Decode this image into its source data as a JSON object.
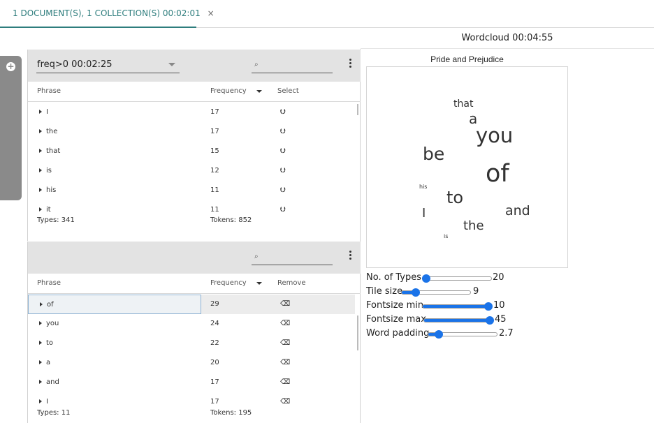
{
  "tab": {
    "label": "1 DOCUMENT(S), 1 COLLECTION(S) 00:02:01",
    "close": "×"
  },
  "right_panel": {
    "title": "Wordcloud 00:04:55"
  },
  "rail": {
    "add_icon": "plus-circle-icon"
  },
  "top_panel": {
    "select_value": "freq>0 00:02:25",
    "search_placeholder": "",
    "columns": {
      "phrase": "Phrase",
      "frequency": "Frequency",
      "action": "Select"
    },
    "rows": [
      {
        "phrase": "I",
        "frequency": "17"
      },
      {
        "phrase": "the",
        "frequency": "17"
      },
      {
        "phrase": "that",
        "frequency": "15"
      },
      {
        "phrase": "is",
        "frequency": "12"
      },
      {
        "phrase": "his",
        "frequency": "11"
      },
      {
        "phrase": "it",
        "frequency": "11"
      }
    ],
    "action_icon": "download-icon",
    "types": "Types: 341",
    "tokens": "Tokens: 852"
  },
  "bottom_panel": {
    "search_placeholder": "",
    "columns": {
      "phrase": "Phrase",
      "frequency": "Frequency",
      "action": "Remove"
    },
    "rows": [
      {
        "phrase": "of",
        "frequency": "29"
      },
      {
        "phrase": "you",
        "frequency": "24"
      },
      {
        "phrase": "to",
        "frequency": "22"
      },
      {
        "phrase": "a",
        "frequency": "20"
      },
      {
        "phrase": "and",
        "frequency": "17"
      },
      {
        "phrase": "I",
        "frequency": "17"
      }
    ],
    "action_icon": "eraser-icon",
    "types": "Types: 11",
    "tokens": "Tokens: 195"
  },
  "wordcloud": {
    "title": "Pride and Prejudice",
    "words": [
      "that",
      "a",
      "you",
      "be",
      "of",
      "his",
      "to",
      "I",
      "and",
      "the",
      "is"
    ]
  },
  "controls": [
    {
      "label": "No. of Types",
      "value": "20",
      "level": 0.05
    },
    {
      "label": "Tile size",
      "value": "9",
      "level": 0.2
    },
    {
      "label": "Fontsize min",
      "value": "10",
      "level": 0.98
    },
    {
      "label": "Fontsize max",
      "value": "45",
      "level": 0.98
    },
    {
      "label": "Word padding",
      "value": "2.7",
      "level": 0.15
    }
  ]
}
